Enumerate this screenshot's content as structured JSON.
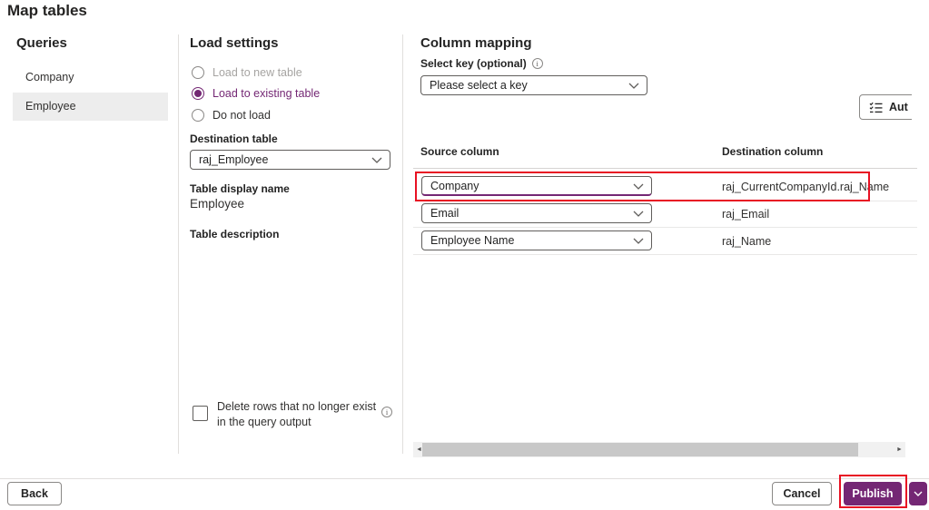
{
  "page": {
    "title": "Map tables"
  },
  "queries": {
    "heading": "Queries",
    "items": [
      {
        "label": "Company",
        "selected": false
      },
      {
        "label": "Employee",
        "selected": true
      }
    ]
  },
  "load_settings": {
    "heading": "Load settings",
    "options": [
      {
        "label": "Load to new table",
        "state": "disabled"
      },
      {
        "label": "Load to existing table",
        "state": "selected"
      },
      {
        "label": "Do not load",
        "state": "default"
      }
    ],
    "destination_table": {
      "label": "Destination table",
      "value": "raj_Employee"
    },
    "table_display_name": {
      "label": "Table display name",
      "value": "Employee"
    },
    "table_description": {
      "label": "Table description",
      "value": ""
    },
    "delete_rows": {
      "label": "Delete rows that no longer exist in the query output",
      "checked": false
    }
  },
  "column_mapping": {
    "heading": "Column mapping",
    "select_key": {
      "label": "Select key (optional)",
      "value": "Please select a key"
    },
    "auto_map_label": "Aut",
    "table": {
      "headers": {
        "source": "Source column",
        "destination": "Destination column"
      },
      "rows": [
        {
          "source": "Company",
          "destination": "raj_CurrentCompanyId.raj_Name",
          "highlighted": true
        },
        {
          "source": "Email",
          "destination": "raj_Email",
          "highlighted": false
        },
        {
          "source": "Employee Name",
          "destination": "raj_Name",
          "highlighted": false
        }
      ]
    }
  },
  "footer": {
    "back_label": "Back",
    "cancel_label": "Cancel",
    "publish_label": "Publish"
  },
  "icons": {
    "info": "i-in-circle",
    "chevron_down": "chevron-down",
    "auto_map": "checklist",
    "scroll_left": "◄",
    "scroll_right": "►"
  },
  "colors": {
    "accent": "#742774",
    "annotation_red": "#e81123",
    "selected_item_bg": "#ededed"
  }
}
